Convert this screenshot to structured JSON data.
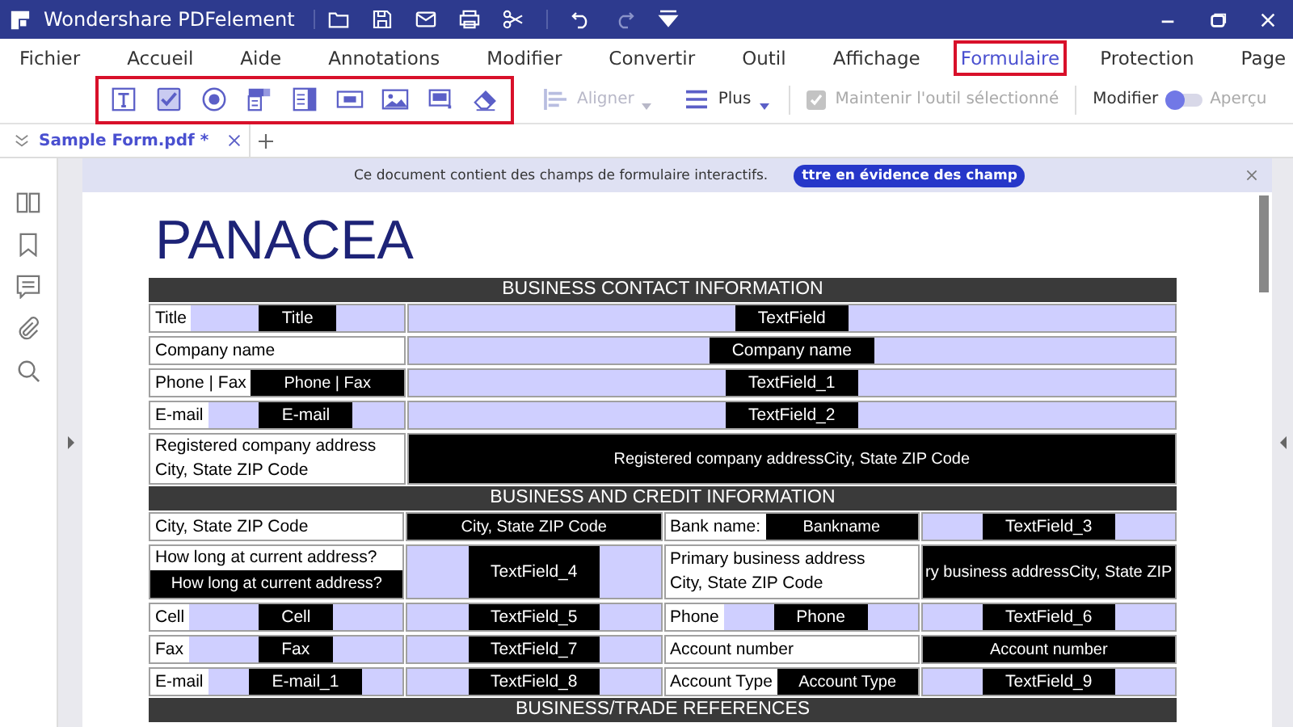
{
  "window": {
    "title": "Wondershare PDFelement"
  },
  "menu": [
    {
      "label": "Fichier",
      "selected": false
    },
    {
      "label": "Accueil",
      "selected": false
    },
    {
      "label": "Aide",
      "selected": false
    },
    {
      "label": "Annotations",
      "selected": false
    },
    {
      "label": "Modifier",
      "selected": false
    },
    {
      "label": "Convertir",
      "selected": false
    },
    {
      "label": "Outil",
      "selected": false
    },
    {
      "label": "Affichage",
      "selected": false
    },
    {
      "label": "Formulaire",
      "selected": true
    },
    {
      "label": "Protection",
      "selected": false
    },
    {
      "label": "Page",
      "selected": false
    }
  ],
  "toolbar": {
    "align": {
      "label": "Aligner",
      "disabled": true
    },
    "more": {
      "label": "Plus",
      "disabled": false
    },
    "keep_tool": {
      "label": "Maintenir l'outil sélectionné",
      "checked": true,
      "disabled": true
    },
    "mode": {
      "left": "Modifier",
      "right": "Aperçu",
      "on": false
    }
  },
  "tabs": [
    {
      "label": "Sample Form.pdf *",
      "selected": true
    }
  ],
  "notice": {
    "message": "Ce document contient des champs de formulaire interactifs.",
    "button": "ttre en évidence des champ"
  },
  "document": {
    "heading": "PANACEA",
    "sections": [
      {
        "title": "BUSINESS CONTACT INFORMATION",
        "rows": [
          [
            {
              "kind": "label_field",
              "label": [
                "Title"
              ],
              "text": "Title"
            },
            {
              "kind": "field",
              "text": "TextField"
            }
          ],
          [
            {
              "kind": "label",
              "label": [
                "Company name"
              ]
            },
            {
              "kind": "field",
              "text": "Company name"
            }
          ],
          [
            {
              "kind": "label_solid",
              "label": [
                "Phone | Fax"
              ],
              "text": "Phone | Fax"
            },
            {
              "kind": "field",
              "text": "TextField_1"
            }
          ],
          [
            {
              "kind": "label_field",
              "label": [
                "E-mail"
              ],
              "text": "E-mail"
            },
            {
              "kind": "field",
              "text": "TextField_2"
            }
          ],
          [
            {
              "kind": "label",
              "label": [
                "Registered company address",
                "City, State ZIP Code"
              ]
            },
            {
              "kind": "solid",
              "text": "Registered company addressCity, State ZIP Code"
            }
          ]
        ]
      },
      {
        "title": "BUSINESS AND CREDIT INFORMATION",
        "rows": [
          [
            {
              "kind": "label",
              "label": [
                "City, State ZIP Code"
              ]
            },
            {
              "kind": "solid",
              "text": "City, State ZIP Code"
            },
            {
              "kind": "label_solid",
              "label": [
                "Bank name:"
              ],
              "text": "Bankname"
            },
            {
              "kind": "field",
              "text": "TextField_3"
            }
          ],
          [
            {
              "kind": "stacked",
              "label": [
                "How long at current address?"
              ],
              "text": "How long at current address?"
            },
            {
              "kind": "field",
              "text": "TextField_4"
            },
            {
              "kind": "label",
              "label": [
                "Primary business address",
                "City, State ZIP Code"
              ]
            },
            {
              "kind": "solid",
              "text": "ry business addressCity, State ZIP"
            }
          ],
          [
            {
              "kind": "label_field",
              "label": [
                "Cell"
              ],
              "text": "Cell"
            },
            {
              "kind": "field",
              "text": "TextField_5"
            },
            {
              "kind": "label_field",
              "label": [
                "Phone"
              ],
              "text": "Phone"
            },
            {
              "kind": "field",
              "text": "TextField_6"
            }
          ],
          [
            {
              "kind": "label_field",
              "label": [
                "Fax"
              ],
              "text": "Fax"
            },
            {
              "kind": "field",
              "text": "TextField_7"
            },
            {
              "kind": "label",
              "label": [
                "Account number"
              ]
            },
            {
              "kind": "solid",
              "text": "Account number"
            }
          ],
          [
            {
              "kind": "label_field",
              "label": [
                "E-mail"
              ],
              "text": "E-mail_1"
            },
            {
              "kind": "field",
              "text": "TextField_8"
            },
            {
              "kind": "label_solid",
              "label": [
                "Account Type"
              ],
              "text": "Account Type"
            },
            {
              "kind": "field",
              "text": "TextField_9"
            }
          ]
        ]
      },
      {
        "title": "BUSINESS/TRADE REFERENCES"
      }
    ]
  }
}
